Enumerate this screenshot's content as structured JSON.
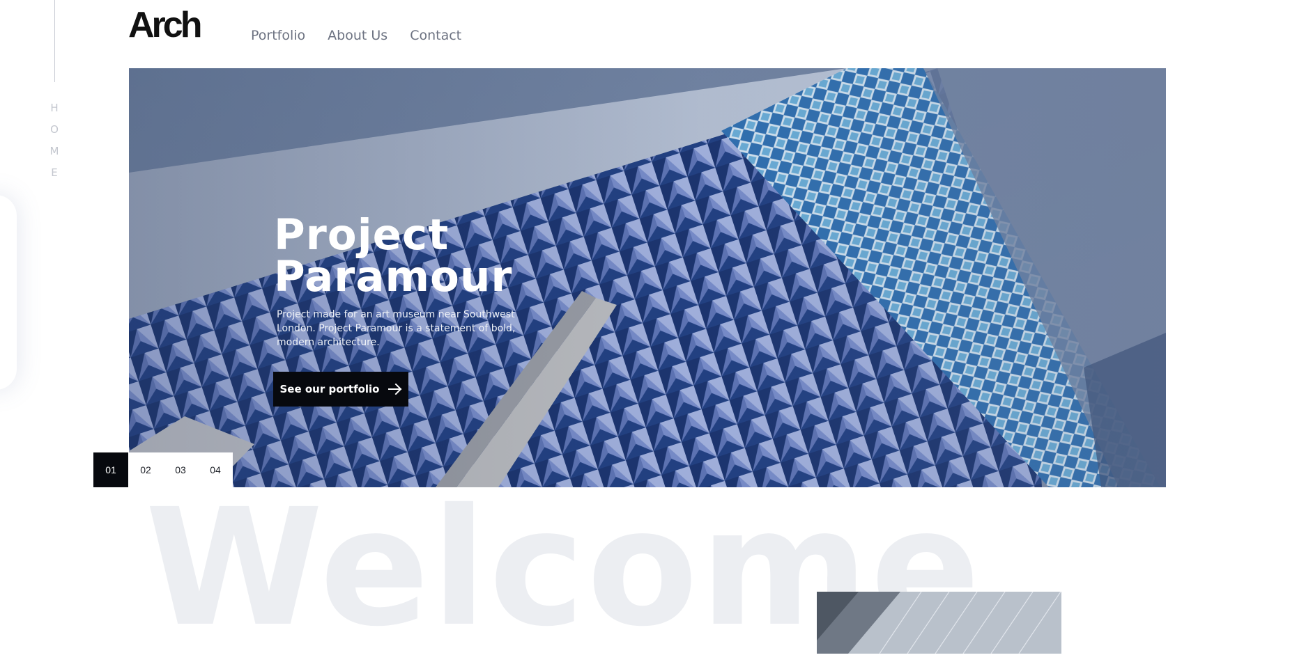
{
  "brand": {
    "logo_text": "Arch"
  },
  "nav": [
    {
      "label": "Portfolio"
    },
    {
      "label": "About Us"
    },
    {
      "label": "Contact"
    }
  ],
  "side_rail": {
    "label_letters": [
      "H",
      "O",
      "M",
      "E"
    ]
  },
  "hero": {
    "title_line1": "Project",
    "title_line2": "Paramour",
    "description": "Project made for an art museum near Southwest London. Project Paramour is a statement of bold, modern architecture.",
    "cta_label": "See our portfolio",
    "cta_icon": "arrow-right-icon",
    "slides": [
      "01",
      "02",
      "03",
      "04"
    ],
    "active_slide": "01"
  },
  "welcome": {
    "heading": "Welcome"
  },
  "colors": {
    "text_primary": "#111111",
    "nav_text": "#6c7281",
    "button_bg": "#07090e",
    "welcome_text": "#eceef2",
    "hero_blue": "#4a5f86"
  }
}
